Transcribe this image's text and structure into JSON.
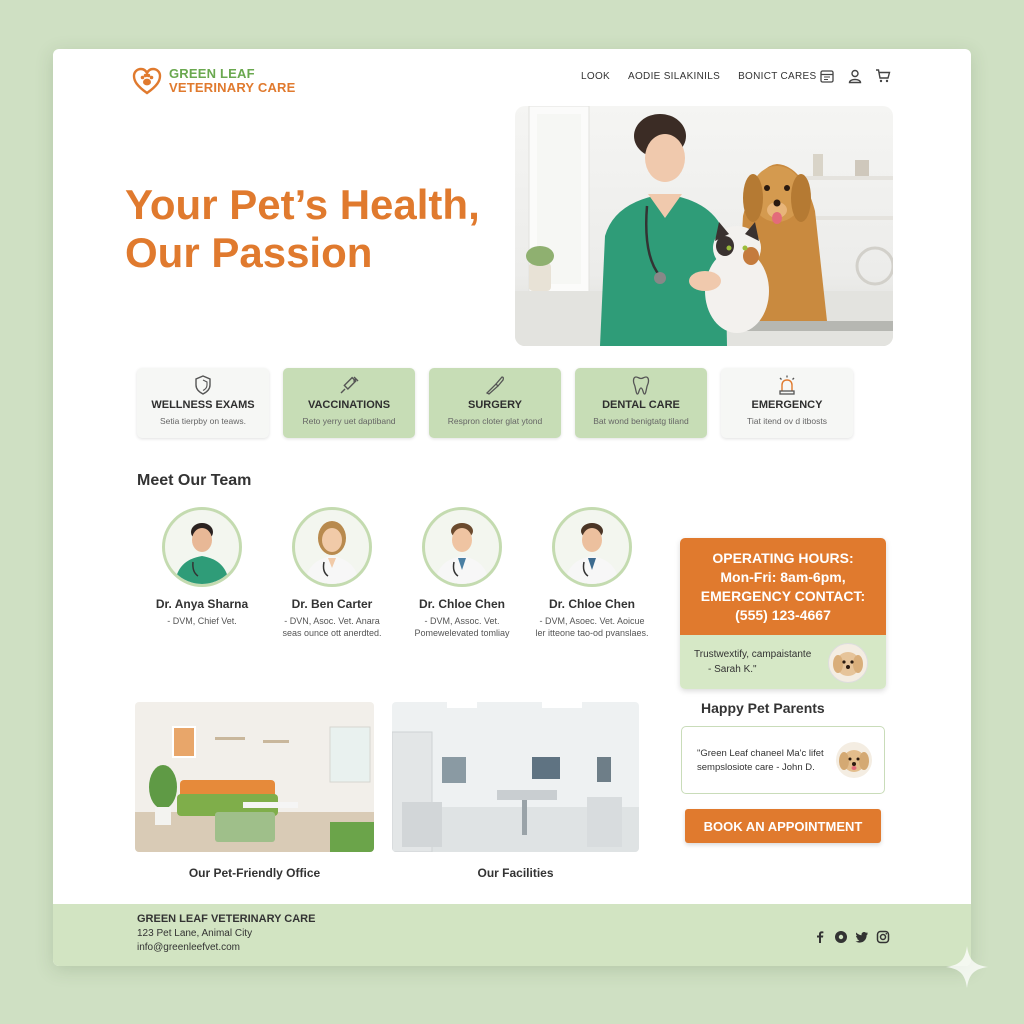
{
  "brand": {
    "line1": "GREEN LEAF",
    "line2": "VETERINARY CARE"
  },
  "nav": {
    "items": [
      "LOOK",
      "AODIE SILAKINILS",
      "BONICT CARES"
    ],
    "icons": [
      "calendar-icon",
      "user-icon",
      "cart-icon"
    ]
  },
  "hero": {
    "title_line1": "Your Pet’s Health,",
    "title_line2": "Our Passion"
  },
  "services": [
    {
      "title": "WELLNESS EXAMS",
      "desc": "Setia tierpby on teaws.",
      "icon": "shield-icon",
      "highlighted": false
    },
    {
      "title": "VACCINATIONS",
      "desc": "Reto yerry uet daptiband",
      "icon": "syringe-icon",
      "highlighted": true
    },
    {
      "title": "SURGERY",
      "desc": "Respron cloter glat ytond",
      "icon": "scalpel-icon",
      "highlighted": true
    },
    {
      "title": "DENTAL CARE",
      "desc": "Bat wond benigtatg tiland",
      "icon": "tooth-icon",
      "highlighted": true
    },
    {
      "title": "EMERGENCY",
      "desc": "Tiat itend ov d itbosts",
      "icon": "siren-icon",
      "highlighted": false
    }
  ],
  "team": {
    "title": "Meet Our Team",
    "members": [
      {
        "name": "Dr. Anya Sharna",
        "role": "- DVM, Chief Vet."
      },
      {
        "name": "Dr. Ben Carter",
        "role": "- DVN, Asoc. Vet. Anara seas ounce ott anerdted."
      },
      {
        "name": "Dr. Chloe Chen",
        "role": "- DVM, Assoc. Vet. Pomewelevated tomliay"
      },
      {
        "name": "Dr. Chloe Chen",
        "role": "- DVM, Asoec. Vet. Aoicue ler itteone tao-od pvanslaes."
      }
    ]
  },
  "hours": {
    "line1": "OPERATING HOURS:",
    "line2": "Mon-Fri: 8am-6pm,",
    "line3": "EMERGENCY CONTACT:",
    "line4": "(555) 123-4667",
    "quote_line1": "Trustwextify, campaistante",
    "quote_line2": "- Sarah K.\""
  },
  "facilities": {
    "caption1": "Our Pet-Friendly Office",
    "caption2": "Our Facilities"
  },
  "testimonials": {
    "title": "Happy Pet Parents",
    "quote_line1": "\"Green Leaf chaneel Ma'c lifet",
    "quote_line2": "sempslosiote care - John D."
  },
  "cta": {
    "book_label": "BOOK AN APPOINTMENT"
  },
  "footer": {
    "name": "GREEN LEAF VETERINARY CARE",
    "address": "123 Pet Lane, Animal City",
    "email": "info@greenleefvet.com",
    "social": [
      "facebook-icon",
      "pinterest-icon",
      "twitter-icon",
      "instagram-icon"
    ]
  },
  "colors": {
    "accent": "#e07a2e",
    "brand_green": "#6aa84f",
    "card_green": "#c7ddb6",
    "background": "#cfe0c3"
  }
}
